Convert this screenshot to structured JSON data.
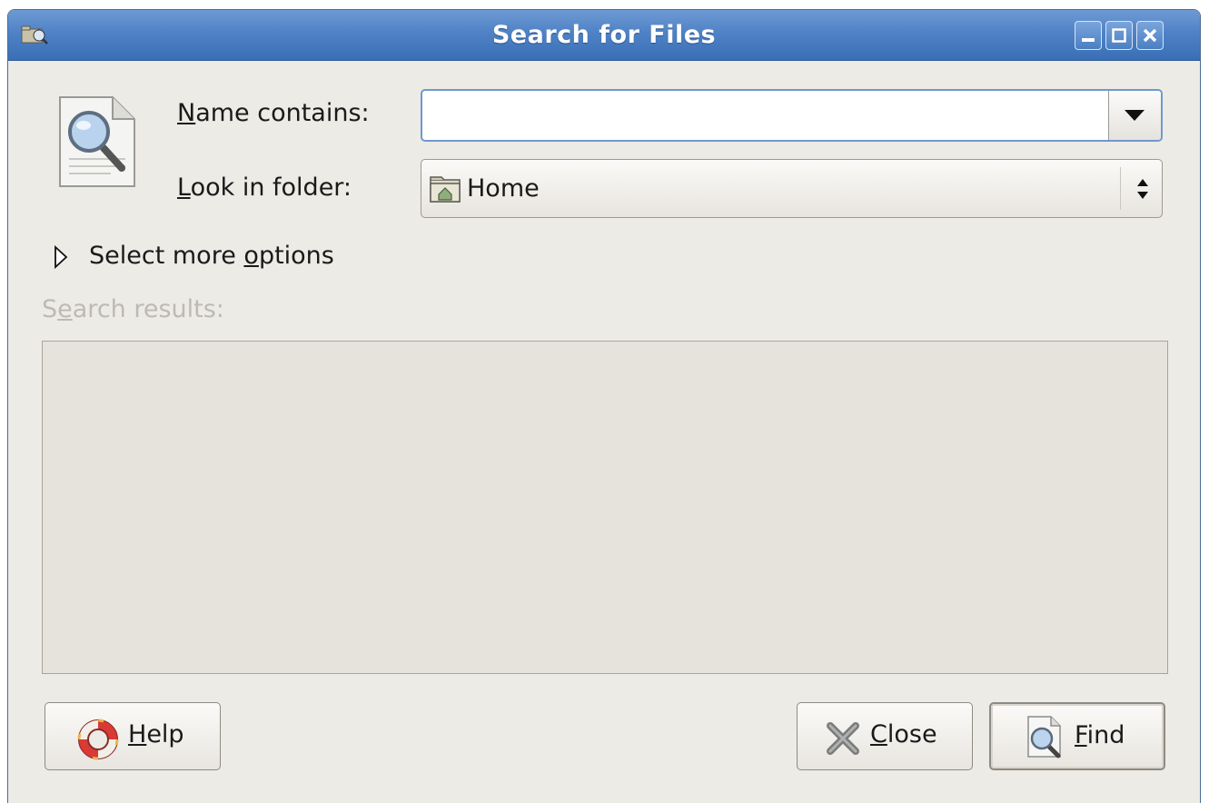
{
  "window": {
    "title": "Search for Files",
    "buttons": [
      "minimize-icon",
      "maximize-icon",
      "close-icon"
    ]
  },
  "form": {
    "name_label_mnemonic": "N",
    "name_label_rest": "ame contains:",
    "name_value": "",
    "folder_label_mnemonic": "L",
    "folder_label_rest": "ook in folder:",
    "folder_value": "Home"
  },
  "options": {
    "label_start": "Select more ",
    "label_mnemonic": "o",
    "label_end": "ptions",
    "expanded": false
  },
  "results": {
    "label_start": "S",
    "label_mnemonic": "e",
    "label_end": "arch results:",
    "items": []
  },
  "buttons": {
    "help_mnemonic": "H",
    "help_rest": "elp",
    "close_mnemonic": "C",
    "close_rest": "lose",
    "find_mnemonic": "F",
    "find_rest": "ind"
  },
  "colors": {
    "titlebar": "#4f82c6",
    "dialog_bg": "#edebe6",
    "focus_border": "#6f98cf"
  }
}
